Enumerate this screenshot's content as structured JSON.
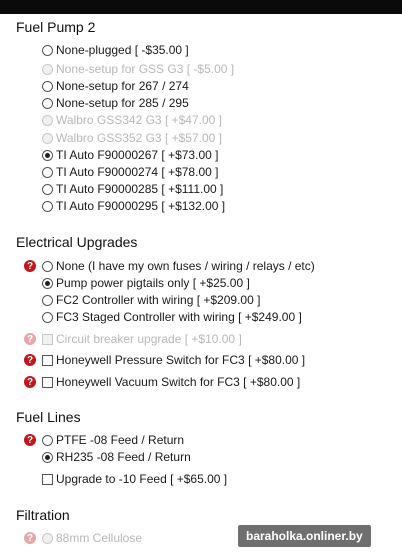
{
  "sections": [
    {
      "title": "Fuel Pump 2",
      "options": [
        {
          "type": "radio",
          "label": "None-plugged [ -$35.00 ]",
          "checked": false,
          "disabled": false,
          "help": false
        },
        {
          "type": "radio",
          "label": "None-setup for GSS G3 [ -$5.00 ]",
          "checked": false,
          "disabled": true,
          "help": false
        },
        {
          "type": "radio",
          "label": "None-setup for 267 / 274",
          "checked": false,
          "disabled": false,
          "help": false
        },
        {
          "type": "radio",
          "label": "None-setup for 285 / 295",
          "checked": false,
          "disabled": false,
          "help": false
        },
        {
          "type": "radio",
          "label": "Walbro GSS342 G3 [ +$47.00 ]",
          "checked": false,
          "disabled": true,
          "help": false
        },
        {
          "type": "radio",
          "label": "Walbro GSS352 G3 [ +$57.00 ]",
          "checked": false,
          "disabled": true,
          "help": false
        },
        {
          "type": "radio",
          "label": "TI Auto F90000267 [ +$73.00 ]",
          "checked": true,
          "disabled": false,
          "help": false
        },
        {
          "type": "radio",
          "label": "TI Auto F90000274 [ +$78.00 ]",
          "checked": false,
          "disabled": false,
          "help": false
        },
        {
          "type": "radio",
          "label": "TI Auto F90000285 [ +$111.00 ]",
          "checked": false,
          "disabled": false,
          "help": false
        },
        {
          "type": "radio",
          "label": "TI Auto F90000295 [ +$132.00 ]",
          "checked": false,
          "disabled": false,
          "help": false
        }
      ]
    },
    {
      "title": "Electrical Upgrades",
      "options": [
        {
          "type": "radio",
          "label": "None (I have my own fuses / wiring / relays / etc)",
          "checked": false,
          "disabled": false,
          "help": true
        },
        {
          "type": "radio",
          "label": "Pump power pigtails only [ +$25.00 ]",
          "checked": true,
          "disabled": false,
          "help": false
        },
        {
          "type": "radio",
          "label": "FC2 Controller with wiring [ +$209.00 ]",
          "checked": false,
          "disabled": false,
          "help": false
        },
        {
          "type": "radio",
          "label": "FC3 Staged Controller with wiring [ +$249.00 ]",
          "checked": false,
          "disabled": false,
          "help": false
        },
        {
          "type": "check",
          "label": "Circuit breaker upgrade [ +$10.00 ]",
          "checked": false,
          "disabled": true,
          "help": true
        },
        {
          "type": "check",
          "label": "Honeywell Pressure Switch for FC3 [ +$80.00 ]",
          "checked": false,
          "disabled": false,
          "help": true
        },
        {
          "type": "check",
          "label": "Honeywell Vacuum Switch for FC3 [ +$80.00 ]",
          "checked": false,
          "disabled": false,
          "help": true
        }
      ]
    },
    {
      "title": "Fuel Lines",
      "options": [
        {
          "type": "radio",
          "label": "PTFE -08 Feed / Return",
          "checked": false,
          "disabled": false,
          "help": true
        },
        {
          "type": "radio",
          "label": "RH235 -08 Feed / Return",
          "checked": true,
          "disabled": false,
          "help": false
        },
        {
          "type": "check",
          "label": "Upgrade to -10 Feed [ +$65.00 ]",
          "checked": false,
          "disabled": false,
          "help": false
        }
      ]
    },
    {
      "title": "Filtration",
      "options": [
        {
          "type": "radio",
          "label": "88mm Cellulose",
          "checked": false,
          "disabled": true,
          "help": true
        }
      ]
    }
  ],
  "help_glyph": "?",
  "watermark": "baraholka.onliner.by"
}
